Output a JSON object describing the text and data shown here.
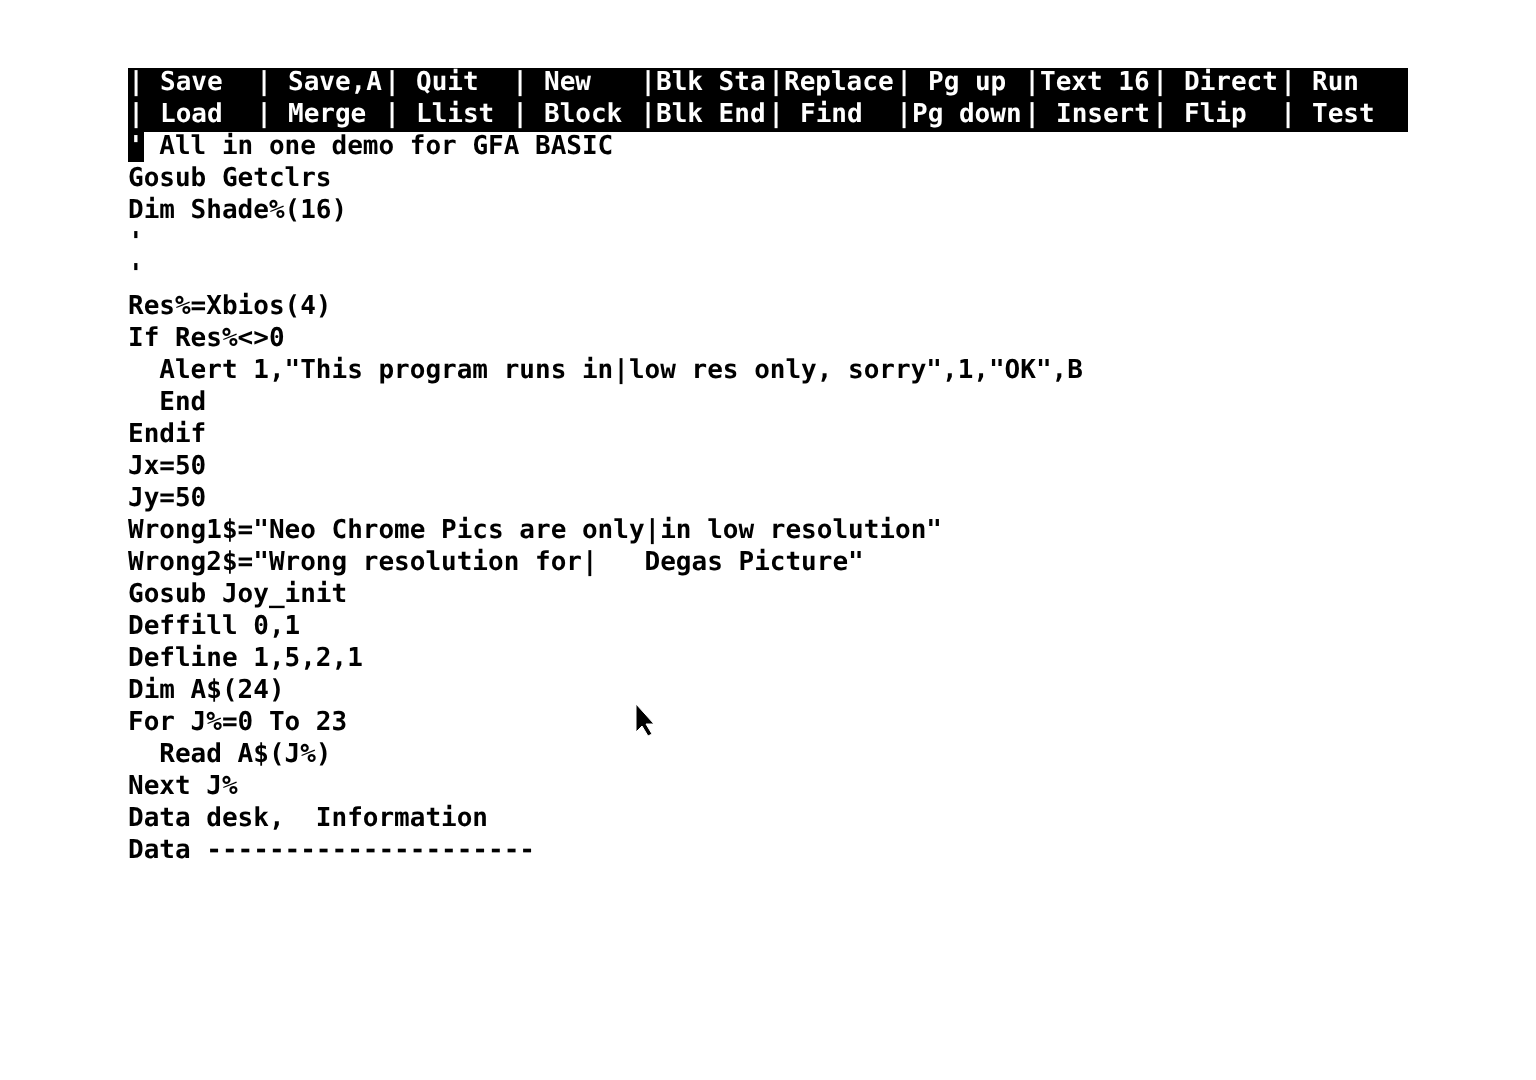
{
  "menu": {
    "separator": "|",
    "rows": [
      {
        "items": [
          "Save",
          "Save,A",
          "Quit",
          "New",
          "Blk Sta",
          "Replace",
          "Pg up",
          "Text 16",
          "Direct",
          "Run"
        ]
      },
      {
        "items": [
          "Load",
          "Merge",
          "Llist",
          "Block",
          "Blk End",
          "Find",
          "Pg down",
          "Insert",
          "Flip",
          "Test"
        ]
      }
    ]
  },
  "editor": {
    "lines": [
      {
        "text": "' All in one demo for GFA BASIC",
        "cursor": true
      },
      {
        "text": "Gosub Getclrs",
        "cursor": false
      },
      {
        "text": "Dim Shade%(16)",
        "cursor": false
      },
      {
        "text": "'",
        "cursor": false
      },
      {
        "text": "'",
        "cursor": false
      },
      {
        "text": "Res%=Xbios(4)",
        "cursor": false
      },
      {
        "text": "If Res%<>0",
        "cursor": false
      },
      {
        "text": "  Alert 1,\"This program runs in|low res only, sorry\",1,\"OK\",B",
        "cursor": false
      },
      {
        "text": "  End",
        "cursor": false
      },
      {
        "text": "Endif",
        "cursor": false
      },
      {
        "text": "Jx=50",
        "cursor": false
      },
      {
        "text": "Jy=50",
        "cursor": false
      },
      {
        "text": "Wrong1$=\"Neo Chrome Pics are only|in low resolution\"",
        "cursor": false
      },
      {
        "text": "Wrong2$=\"Wrong resolution for|   Degas Picture\"",
        "cursor": false
      },
      {
        "text": "Gosub Joy_init",
        "cursor": false
      },
      {
        "text": "Deffill 0,1",
        "cursor": false
      },
      {
        "text": "Defline 1,5,2,1",
        "cursor": false
      },
      {
        "text": "Dim A$(24)",
        "cursor": false
      },
      {
        "text": "For J%=0 To 23",
        "cursor": false
      },
      {
        "text": "  Read A$(J%)",
        "cursor": false
      },
      {
        "text": "Next J%",
        "cursor": false
      },
      {
        "text": "Data desk,  Information",
        "cursor": false
      },
      {
        "text": "Data ---------------------",
        "cursor": false
      }
    ]
  }
}
